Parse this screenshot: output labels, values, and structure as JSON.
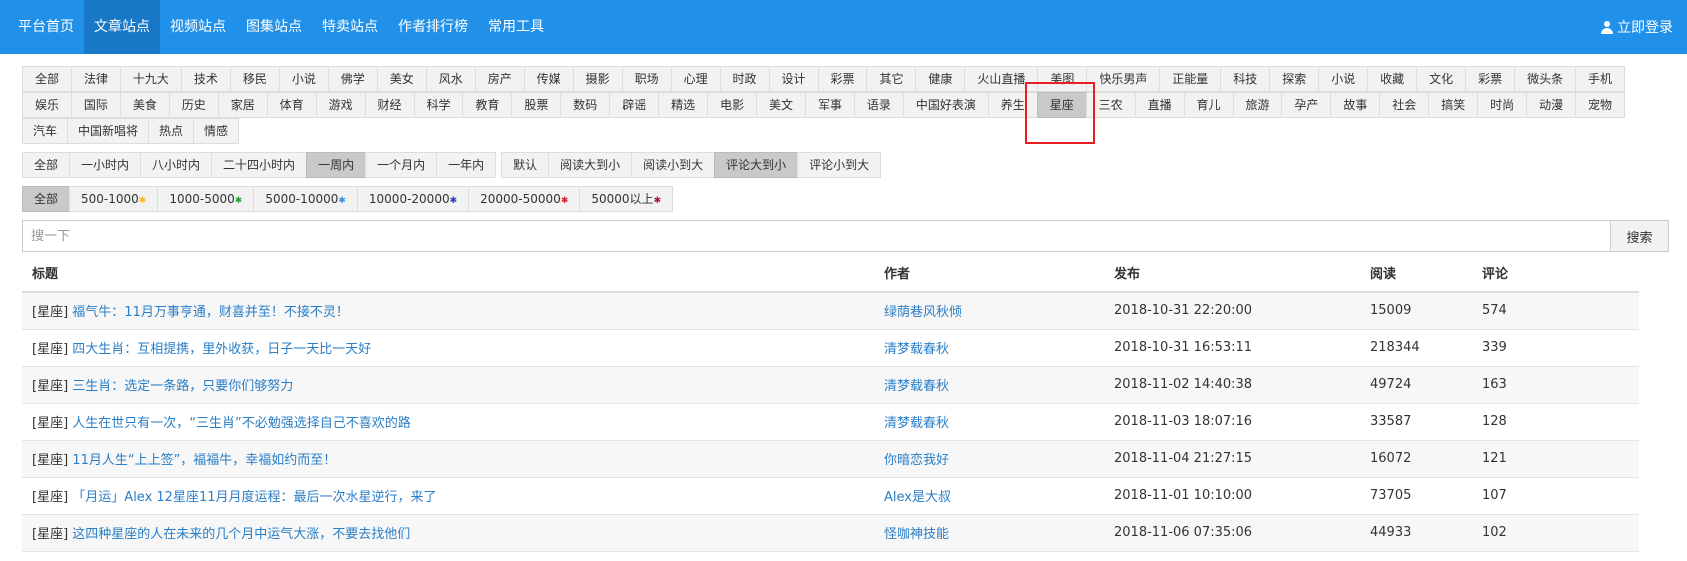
{
  "nav": {
    "items": [
      "平台首页",
      "文章站点",
      "视频站点",
      "图集站点",
      "特卖站点",
      "作者排行榜",
      "常用工具"
    ],
    "active_index": 1,
    "login_label": "立即登录"
  },
  "categories": {
    "row1": [
      "全部",
      "法律",
      "十九大",
      "技术",
      "移民",
      "小说",
      "佛学",
      "美女",
      "风水",
      "房产",
      "传媒",
      "摄影",
      "职场",
      "心理",
      "时政",
      "设计",
      "彩票",
      "其它",
      "健康",
      "火山直播",
      "美图",
      "快乐男声",
      "正能量",
      "科技",
      "探索",
      "小说",
      "收藏",
      "文化",
      "彩票",
      "微头条",
      "手机"
    ],
    "row2": [
      "娱乐",
      "国际",
      "美食",
      "历史",
      "家居",
      "体育",
      "游戏",
      "财经",
      "科学",
      "教育",
      "股票",
      "数码",
      "辟谣",
      "精选",
      "电影",
      "美文",
      "军事",
      "语录",
      "中国好表演",
      "养生",
      "星座",
      "三农",
      "直播",
      "育儿",
      "旅游",
      "孕产",
      "故事",
      "社会",
      "搞笑",
      "时尚",
      "动漫",
      "宠物"
    ],
    "row3": [
      "汽车",
      "中国新唱将",
      "热点",
      "情感"
    ],
    "active": "星座"
  },
  "time_filter": {
    "options": [
      "全部",
      "一小时内",
      "八小时内",
      "二十四小时内",
      "一周内",
      "一个月内",
      "一年内"
    ],
    "active": "一周内"
  },
  "sort_filter": {
    "options": [
      "默认",
      "阅读大到小",
      "阅读小到大",
      "评论大到小",
      "评论小到大"
    ],
    "active": "评论大到小"
  },
  "read_filter": {
    "options": [
      {
        "label": "全部",
        "star": "",
        "color": ""
      },
      {
        "label": "500-1000",
        "star": "✱",
        "color": "#f5b82e"
      },
      {
        "label": "1000-5000",
        "star": "✱",
        "color": "#2e9d2e"
      },
      {
        "label": "5000-10000",
        "star": "✱",
        "color": "#3b8fe0"
      },
      {
        "label": "10000-20000",
        "star": "✱",
        "color": "#2a3fc7"
      },
      {
        "label": "20000-50000",
        "star": "✱",
        "color": "#e02020"
      },
      {
        "label": "50000以上",
        "star": "✱",
        "color": "#b0122c"
      }
    ],
    "active": "全部"
  },
  "search": {
    "placeholder": "搜一下",
    "button_label": "搜索"
  },
  "table": {
    "headers": {
      "title": "标题",
      "author": "作者",
      "published": "发布",
      "reads": "阅读",
      "comments": "评论"
    },
    "rows": [
      {
        "tag": "[星座]",
        "title": "福气牛：11月万事亨通，财喜并至！不接不灵！",
        "author": "绿荫巷风秋倾",
        "published": "2018-10-31 22:20:00",
        "reads": "15009",
        "comments": "574"
      },
      {
        "tag": "[星座]",
        "title": "四大生肖：互相提携，里外收获，日子一天比一天好",
        "author": "清梦载春秋",
        "published": "2018-10-31 16:53:11",
        "reads": "218344",
        "comments": "339"
      },
      {
        "tag": "[星座]",
        "title": "三生肖：选定一条路，只要你们够努力",
        "author": "清梦载春秋",
        "published": "2018-11-02 14:40:38",
        "reads": "49724",
        "comments": "163"
      },
      {
        "tag": "[星座]",
        "title": "人生在世只有一次，“三生肖”不必勉强选择自己不喜欢的路",
        "author": "清梦载春秋",
        "published": "2018-11-03 18:07:16",
        "reads": "33587",
        "comments": "128"
      },
      {
        "tag": "[星座]",
        "title": "11月人生“上上签”，福福牛，幸福如约而至！",
        "author": "你暗恋我好",
        "published": "2018-11-04 21:27:15",
        "reads": "16072",
        "comments": "121"
      },
      {
        "tag": "[星座]",
        "title": "「月运」Alex 12星座11月月度运程：最后一次水星逆行，来了",
        "author": "Alex是大叔",
        "published": "2018-11-01 10:10:00",
        "reads": "73705",
        "comments": "107"
      },
      {
        "tag": "[星座]",
        "title": "这四种星座的人在未来的几个月中运气大涨，不要去找他们",
        "author": "怪咖神技能",
        "published": "2018-11-06 07:35:06",
        "reads": "44933",
        "comments": "102"
      }
    ]
  }
}
